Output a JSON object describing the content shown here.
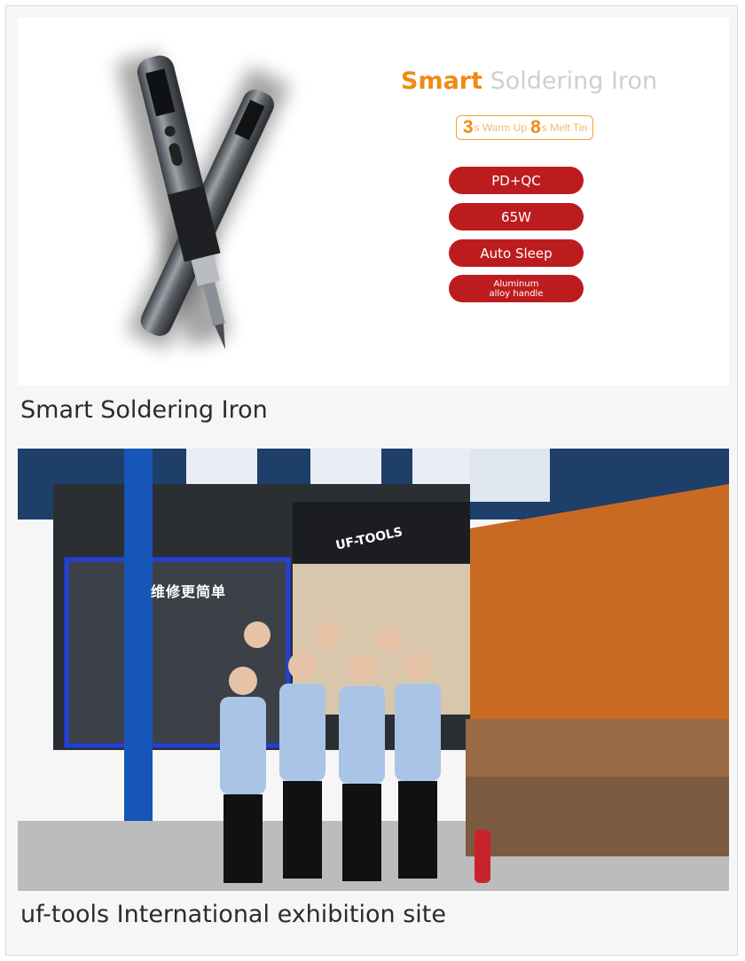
{
  "product": {
    "headline_word1": "Smart",
    "headline_word2": "Soldering Iron",
    "warmup_num1": "3",
    "warmup_text1": "s Warm Up",
    "warmup_num2": "8",
    "warmup_text2": "s Melt Tin",
    "features": [
      "PD+QC",
      "65W",
      "Auto Sleep"
    ],
    "feature_handle_line1": "Aluminum",
    "feature_handle_line2": "alloy handle",
    "caption": "Smart Soldering Iron"
  },
  "exhibition": {
    "sign_cn": "维修更简单",
    "logo_text": "UF-TOOLS",
    "caption": "uf-tools International exhibition site"
  },
  "colors": {
    "accent_orange": "#f08a14",
    "headline_gray": "#cfcfcf",
    "pill_red": "#bd1c1f",
    "booth_wall_orange": "#c96a22",
    "staff_shirt": "#aac4e6"
  },
  "icons": [
    "soldering-iron-illustration",
    "exhibition-photo"
  ]
}
